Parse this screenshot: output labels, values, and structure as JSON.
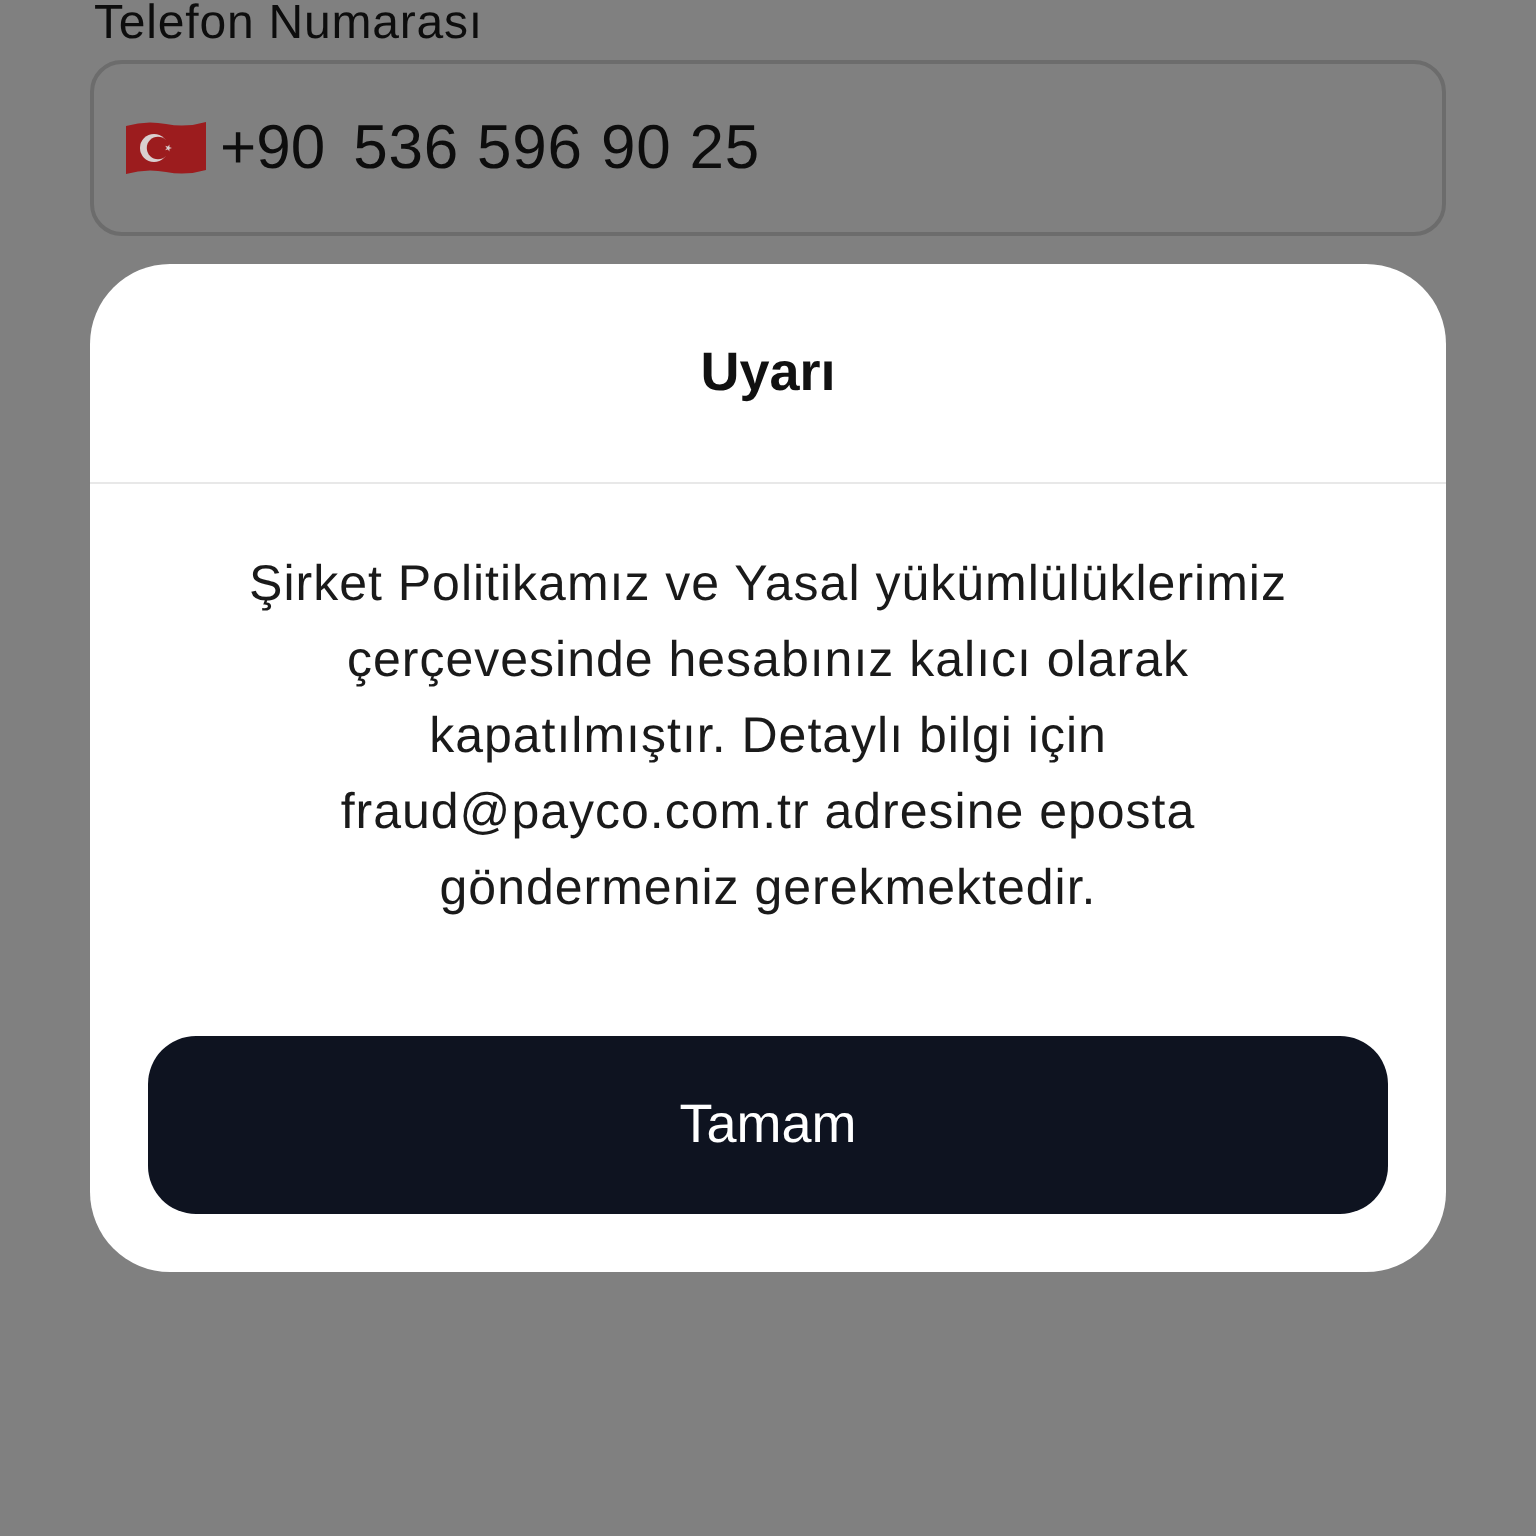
{
  "phone_field": {
    "label": "Telefon Numarası",
    "country_code": "+90",
    "value": "536 596 90 25"
  },
  "dialog": {
    "title": "Uyarı",
    "message": "Şirket Politikamız ve Yasal yükümlülüklerimiz çerçevesinde hesabınız kalıcı olarak kapatılmıştır. Detaylı bilgi için fraud@payco.com.tr adresine eposta göndermeniz gerekmektedir.",
    "buttons": [
      "Tamam"
    ]
  }
}
